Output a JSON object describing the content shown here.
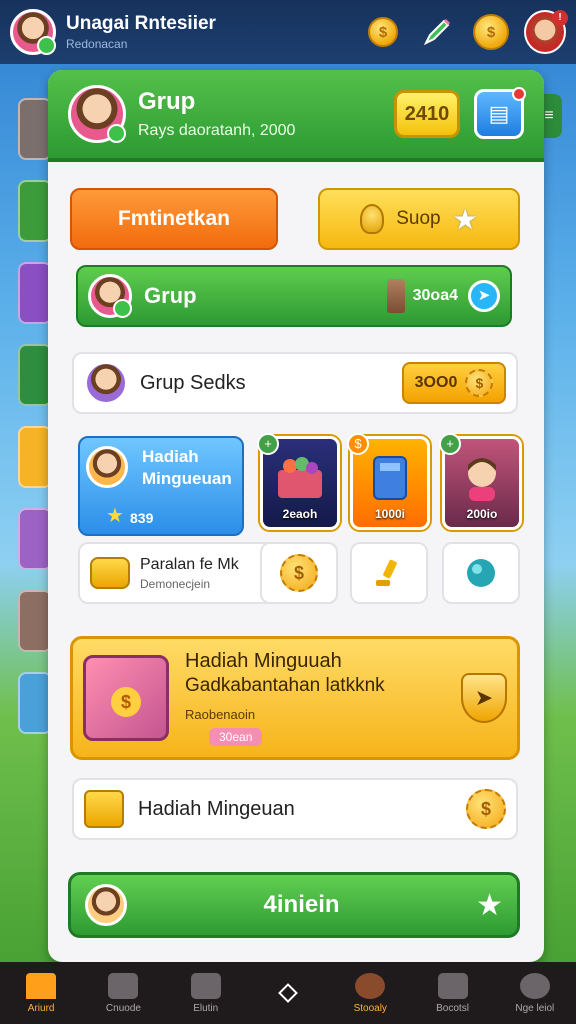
{
  "topbar": {
    "title": "Unagai Rntesiier",
    "subtitle": "Redonacan"
  },
  "panel": {
    "title": "Grup",
    "subtitle": "Rays daoratanh, 2000",
    "count": "2410"
  },
  "buttons": {
    "orange_label": "Fmtinetkan",
    "yellow_label": "Suop"
  },
  "group_row": {
    "label": "Grup",
    "value": "30oa4"
  },
  "group_search": {
    "label": "Grup Sedks",
    "value": "3OO0"
  },
  "tiles": {
    "main_title": "Hadiah Mingueuan",
    "main_value": "839",
    "items": [
      {
        "value": "2eaoh"
      },
      {
        "value": "1000i"
      },
      {
        "value": "200io"
      }
    ]
  },
  "small_card": {
    "title": "Paralan fe Mk",
    "subtitle": "Demonecjein"
  },
  "chest_card": {
    "title": "Hadiah Minguuah",
    "subtitle": "Gadkabantahan latkknk",
    "detail": "Raobenaoin",
    "pill": "30ean"
  },
  "weekly_card": {
    "label": "Hadiah Mingeuan"
  },
  "big_button": {
    "label": "4iniein"
  },
  "nav": [
    {
      "label": "Ariurd"
    },
    {
      "label": "Cnuode"
    },
    {
      "label": "Elutin"
    },
    {
      "label": ""
    },
    {
      "label": "Stooaly"
    },
    {
      "label": "Bocotsl"
    },
    {
      "label": "Nge leiol"
    }
  ]
}
